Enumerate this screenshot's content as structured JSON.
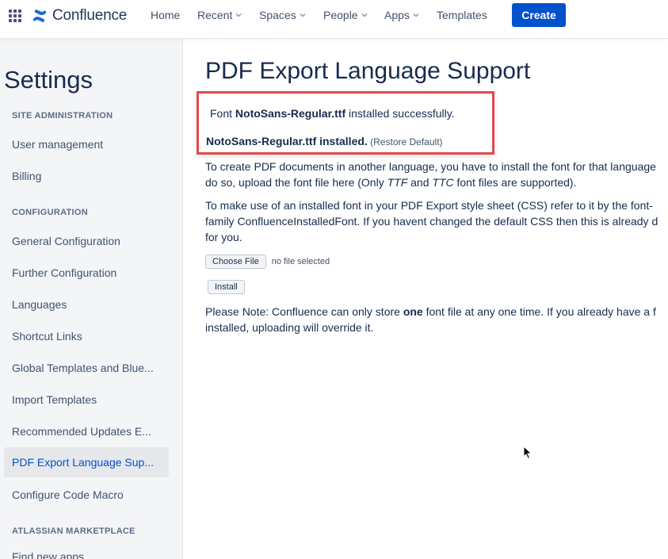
{
  "topnav": {
    "logo_text": "Confluence",
    "items": [
      {
        "label": "Home",
        "has_dropdown": false
      },
      {
        "label": "Recent",
        "has_dropdown": true
      },
      {
        "label": "Spaces",
        "has_dropdown": true
      },
      {
        "label": "People",
        "has_dropdown": true
      },
      {
        "label": "Apps",
        "has_dropdown": true
      },
      {
        "label": "Templates",
        "has_dropdown": false
      }
    ],
    "create_label": "Create"
  },
  "sidebar": {
    "title": "Settings",
    "sections": [
      {
        "label": "SITE ADMINISTRATION"
      },
      {
        "label": "CONFIGURATION"
      },
      {
        "label": "ATLASSIAN MARKETPLACE"
      }
    ],
    "items": [
      {
        "label": "User management"
      },
      {
        "label": "Billing"
      },
      {
        "label": "General Configuration"
      },
      {
        "label": "Further Configuration"
      },
      {
        "label": "Languages"
      },
      {
        "label": "Shortcut Links"
      },
      {
        "label": "Global Templates and Blue..."
      },
      {
        "label": "Import Templates"
      },
      {
        "label": "Recommended Updates E..."
      },
      {
        "label": "PDF Export Language Sup...",
        "active": true
      },
      {
        "label": "Configure Code Macro"
      },
      {
        "label": "Find new apps"
      }
    ]
  },
  "main": {
    "title": "PDF Export Language Support",
    "notice": {
      "prefix": "Font ",
      "font_name": "NotoSans-Regular.ttf",
      "suffix": " installed successfully.",
      "installed_text": "NotoSans-Regular.ttf installed.",
      "restore_open": " (",
      "restore_label": "Restore Default",
      "restore_close": ")"
    },
    "para1": {
      "line1": "To create PDF documents in another language, you have to install the font for that language",
      "line2_a": "do so, upload the font file here (Only ",
      "ttf": "TTF",
      "and": " and ",
      "ttc": "TTC",
      "line2_b": " font files are supported)."
    },
    "para2": {
      "line1": "To make use of an installed font in your PDF Export style sheet (CSS) refer to it by the font-",
      "line2": "family ConfluenceInstalledFont. If you havent changed the default CSS then this is already d",
      "line3": "for you."
    },
    "choose_file_label": "Choose File",
    "no_file_text": "no file selected",
    "install_label": "Install",
    "note": {
      "line1_a": "Please Note: Confluence can only store ",
      "bold": "one",
      "line1_b": " font file at any one time. If you already have a f",
      "line2": "installed, uploading will override it."
    }
  },
  "colors": {
    "primary": "#0052cc",
    "notice_border": "#e5484d",
    "sidebar_bg": "#f4f5f7"
  }
}
